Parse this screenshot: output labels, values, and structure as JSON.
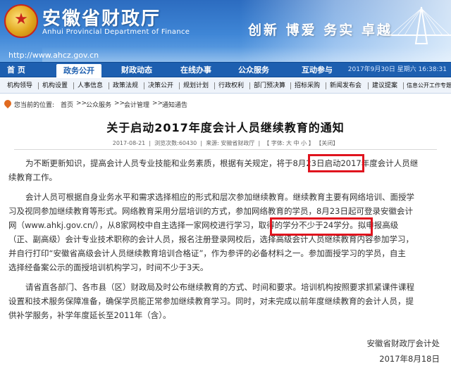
{
  "header": {
    "title": "安徽省财政厅",
    "subtitle": "Anhui Provincial Department of Finance",
    "url": "http://www.ahcz.gov.cn",
    "slogan": "创新 博爱 务实 卓越",
    "emblem_icon": "national-emblem-icon",
    "brand_color": "#2c6cc0"
  },
  "nav": {
    "items": [
      "首    页",
      "政务公开",
      "财政动态",
      "在线办事",
      "公众服务",
      "互动参与"
    ],
    "active": "政务公开",
    "date": "2017年9月30日 星期六 16:38:31"
  },
  "subnav": {
    "items": [
      "机构领导",
      "机构设置",
      "人事信息",
      "政策法规",
      "决策公开",
      "规划计划",
      "行政权利",
      "部门预决算",
      "招标采购",
      "新闻发布会",
      "建议提案",
      "信息公开工作专题"
    ]
  },
  "breadcrumb": {
    "label": "您当前的位置:",
    "items": [
      "首页",
      "公众服务",
      "会计管理",
      "通知通告"
    ],
    "separator": ">>"
  },
  "article": {
    "title": "关于启动2017年度会计人员继续教育的通知",
    "meta_date": "2017-08-21",
    "meta_views": "浏览次数:60430",
    "meta_source": "来源: 安徽省财政厅",
    "meta_font": "【 字体: 大  中  小 】",
    "meta_close": "【关闭】",
    "p1": [
      "为不断更新知识，提高会计人员专业技能和业务素质，根据有关规定，将于8月23日启动2017年度会计人员继",
      "续教育工作。"
    ],
    "p2": [
      "会计人员可根据自身业务水平和需求选择相应的形式和层次参加继续教育。继续教育主要有网络培训、面授学",
      "习及视同参加继续教育等形式。网络教育采用分层培训的方式，参加网络教育的学员，8月23日起可登录安徽会计",
      "网（www.ahkj.gov.cn/），从8家网校中自主选择一家网校进行学习，取得的学分不少于24学分。拟申报高级",
      "（正、副高级）会计专业技术职称的会计人员，报名注册登录网校后，选择高级会计人员继续教育内容参加学习，",
      "并自行打印“安徽省高级会计人员继续教育培训合格证”，作为参评的必备材料之一。参加面授学习的学员，自主",
      "选择经备案公示的面授培训机构学习，时间不少于3天。"
    ],
    "p3": [
      "请省直各部门、各市县（区）财政局及时公布继续教育的方式、时间和要求。培训机构按照要求抓紧课件课程",
      "设置和技术服务保障准备，确保学员能正常参加继续教育学习。同时，对未完成以前年度继续教育的会计人员，提",
      "供补学服务，补学年度延长至2011年（含）。"
    ],
    "signer": "安徽省财政厅会计处",
    "sign_date": "2017年8月18日"
  },
  "highlight_color": "#e0141e"
}
